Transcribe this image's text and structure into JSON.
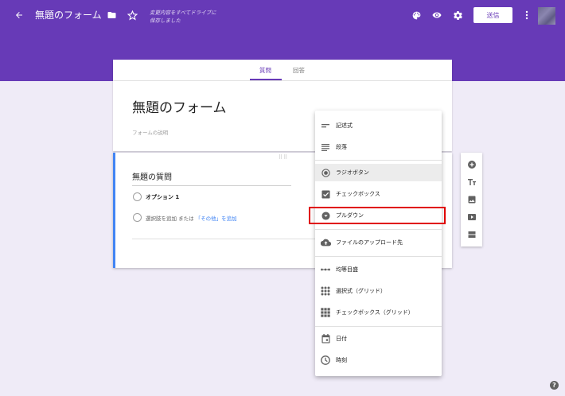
{
  "header": {
    "title": "無題のフォーム",
    "saved_status_line1": "変更内容をすべてドライブに",
    "saved_status_line2": "保存しました",
    "send_label": "送信",
    "icons": [
      "back-arrow-icon",
      "folder-icon",
      "star-icon",
      "palette-icon",
      "preview-eye-icon",
      "settings-gear-icon",
      "more-vert-icon"
    ],
    "color": "#673ab7"
  },
  "tabs": [
    {
      "label": "質問",
      "active": true
    },
    {
      "label": "回答",
      "active": false
    }
  ],
  "form": {
    "title": "無題のフォーム",
    "description_placeholder": "フォームの説明"
  },
  "question": {
    "title": "無題の質問",
    "option1": "オプション 1",
    "add_option": "選択肢を追加",
    "or_text": "または",
    "add_other": "「その他」を追加"
  },
  "question_type_menu": {
    "items": [
      {
        "label": "記述式",
        "icon": "short-text-icon"
      },
      {
        "label": "段落",
        "icon": "paragraph-icon"
      },
      {
        "label": "ラジオボタン",
        "icon": "radio-button-icon",
        "highlighted": true
      },
      {
        "label": "チェックボックス",
        "icon": "checkbox-icon"
      },
      {
        "label": "プルダウン",
        "icon": "dropdown-icon",
        "annotated": true
      },
      {
        "label": "ファイルのアップロード先",
        "icon": "cloud-upload-icon"
      },
      {
        "label": "均等目盛",
        "icon": "linear-scale-icon"
      },
      {
        "label": "選択式（グリッド）",
        "icon": "grid-icon"
      },
      {
        "label": "チェックボックス（グリッド）",
        "icon": "checkbox-grid-icon"
      },
      {
        "label": "日付",
        "icon": "calendar-icon"
      },
      {
        "label": "時刻",
        "icon": "clock-icon"
      }
    ]
  },
  "toolbar": {
    "icons": [
      "add-question-icon",
      "add-title-icon",
      "add-image-icon",
      "add-video-icon",
      "add-section-icon"
    ]
  },
  "help_label": "?"
}
